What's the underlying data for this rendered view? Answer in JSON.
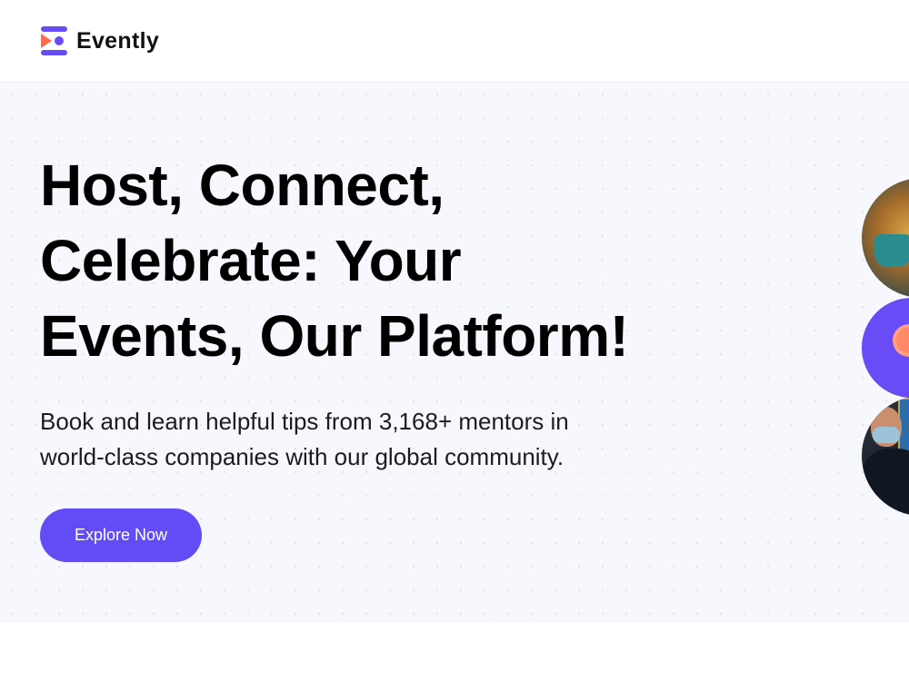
{
  "header": {
    "brand_name": "Evently",
    "logo_icon": "evently-logo-icon",
    "colors": {
      "logo_primary": "#6a4cf6",
      "logo_accent": "#ff6b4a"
    }
  },
  "hero": {
    "title_lines": [
      "Host, Connect,",
      "Celebrate: Your",
      "Events, Our Platform!"
    ],
    "description_lines": [
      "Book and learn helpful tips from 3,168+ mentors in",
      "world-class companies with our global community."
    ],
    "cta_label": "Explore Now",
    "colors": {
      "background": "#f6f8fd",
      "cta": "#624cf5",
      "cta_text": "#ffffff"
    },
    "images": [
      "hero-image-cafe",
      "hero-image-flower",
      "hero-image-person"
    ]
  }
}
